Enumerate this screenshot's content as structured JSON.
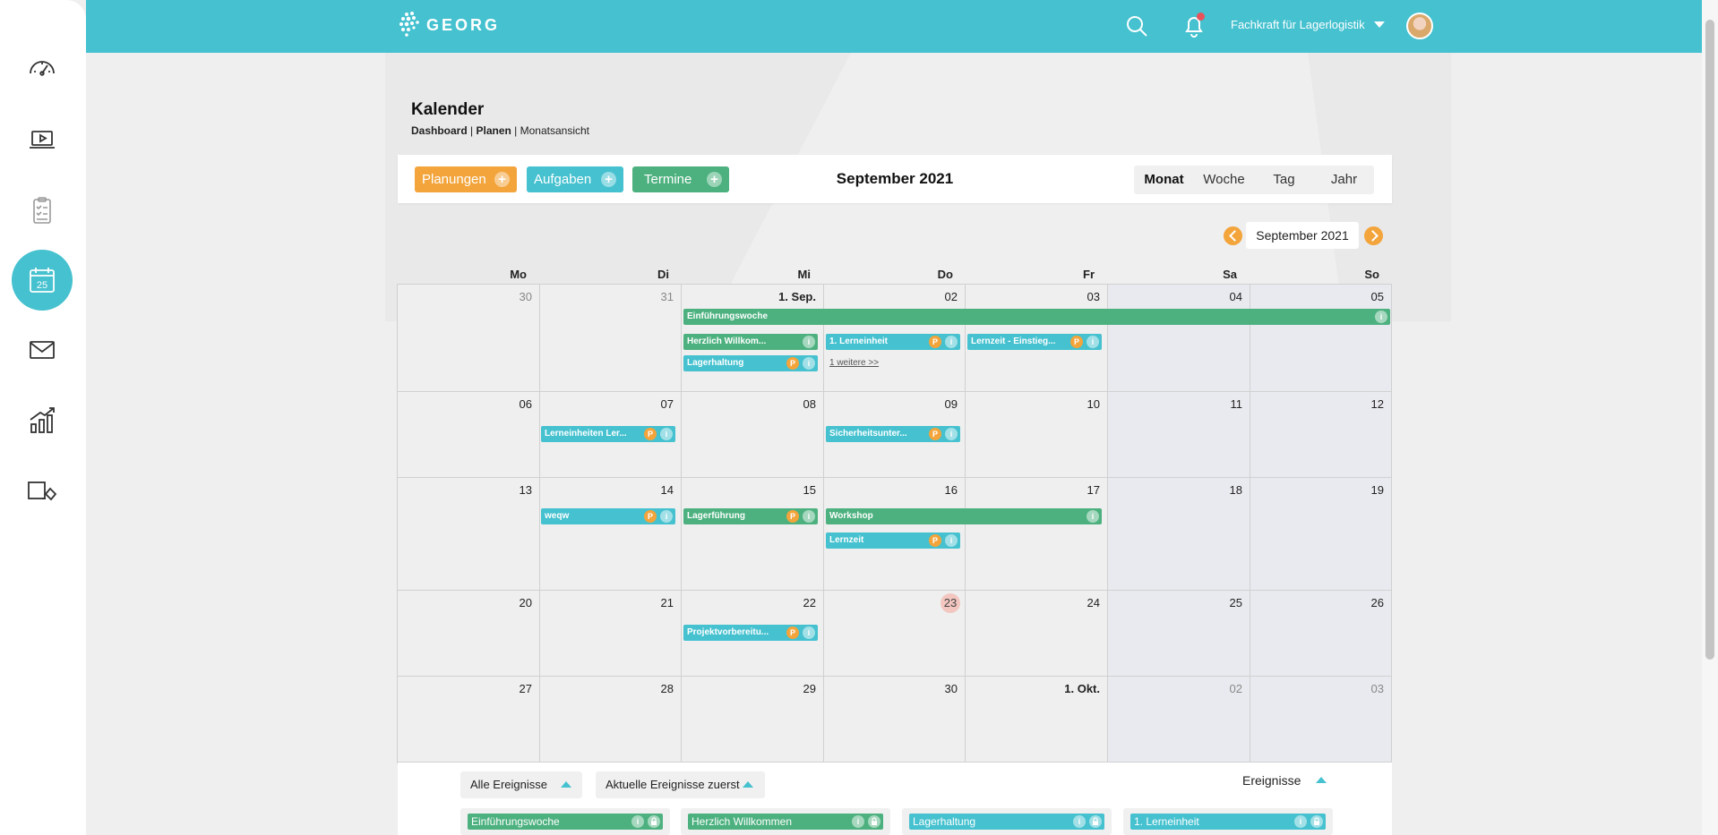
{
  "app": {
    "logo_text": "GEORG"
  },
  "header": {
    "role": "Fachkraft für Lagerlogistik"
  },
  "sidebar": {
    "items": [
      {
        "name": "dashboard-icon"
      },
      {
        "name": "video-icon"
      },
      {
        "name": "checklist-icon"
      },
      {
        "name": "calendar-icon",
        "label": "25",
        "active": true
      },
      {
        "name": "mail-icon"
      },
      {
        "name": "statistics-icon"
      },
      {
        "name": "tools-icon"
      }
    ]
  },
  "page": {
    "title": "Kalender",
    "breadcrumb": {
      "a": "Dashboard",
      "sep1": " | ",
      "b": "Planen",
      "sep2": " | ",
      "c": "Monatsansicht"
    }
  },
  "toolbar": {
    "planungen": "Planungen",
    "aufgaben": "Aufgaben",
    "termine": "Termine",
    "plus": "+",
    "month_title": "September 2021",
    "views": [
      "Monat",
      "Woche",
      "Tag",
      "Jahr"
    ],
    "selected_view": "Monat"
  },
  "nav": {
    "label": "September 2021"
  },
  "calendar": {
    "weekdays": [
      "Mo",
      "Di",
      "Mi",
      "Do",
      "Fr",
      "Sa",
      "So"
    ],
    "weeks": [
      [
        "30",
        "31",
        "1. Sep.",
        "02",
        "03",
        "04",
        "05"
      ],
      [
        "06",
        "07",
        "08",
        "09",
        "10",
        "11",
        "12"
      ],
      [
        "13",
        "14",
        "15",
        "16",
        "17",
        "18",
        "19"
      ],
      [
        "20",
        "21",
        "22",
        "23",
        "24",
        "25",
        "26"
      ],
      [
        "27",
        "28",
        "29",
        "30",
        "1. Okt.",
        "02",
        "03"
      ]
    ],
    "today": "23",
    "events": [
      {
        "title": "Einführungswoche",
        "color": "green"
      },
      {
        "title": "Herzlich Willkom...",
        "color": "green"
      },
      {
        "title": "Lagerhaltung",
        "color": "teal",
        "p": "P"
      },
      {
        "title": "1. Lerneinheit",
        "color": "teal",
        "p": "P"
      },
      {
        "title": "Lernzeit - Einstieg...",
        "color": "teal",
        "p": "P"
      },
      {
        "title": "Lerneinheiten Ler...",
        "color": "teal",
        "p": "P"
      },
      {
        "title": "Sicherheitsunter...",
        "color": "teal",
        "p": "P"
      },
      {
        "title": "weqw",
        "color": "teal",
        "p": "P"
      },
      {
        "title": "Lagerführung",
        "color": "green",
        "p": "P"
      },
      {
        "title": "Workshop",
        "color": "green"
      },
      {
        "title": "Lernzeit",
        "color": "teal",
        "p": "P"
      },
      {
        "title": "Projektvorbereitu...",
        "color": "teal",
        "p": "P"
      }
    ],
    "more_link": "1 weitere >>",
    "info_glyph": "i"
  },
  "bottom": {
    "filter_all": "Alle Ereignisse",
    "filter_current": "Aktuelle Ereignisse zuerst",
    "events_label": "Ereignisse",
    "cards": [
      {
        "title": "Einführungswoche",
        "color": "green"
      },
      {
        "title": "Herzlich Willkommen",
        "color": "green"
      },
      {
        "title": "Lagerhaltung",
        "color": "teal"
      },
      {
        "title": "1. Lerneinheit",
        "color": "teal"
      }
    ]
  },
  "colors": {
    "accent": "#45c1cf",
    "green": "#4cb17f",
    "orange": "#f3a43b",
    "today": "#f3c6c0"
  }
}
